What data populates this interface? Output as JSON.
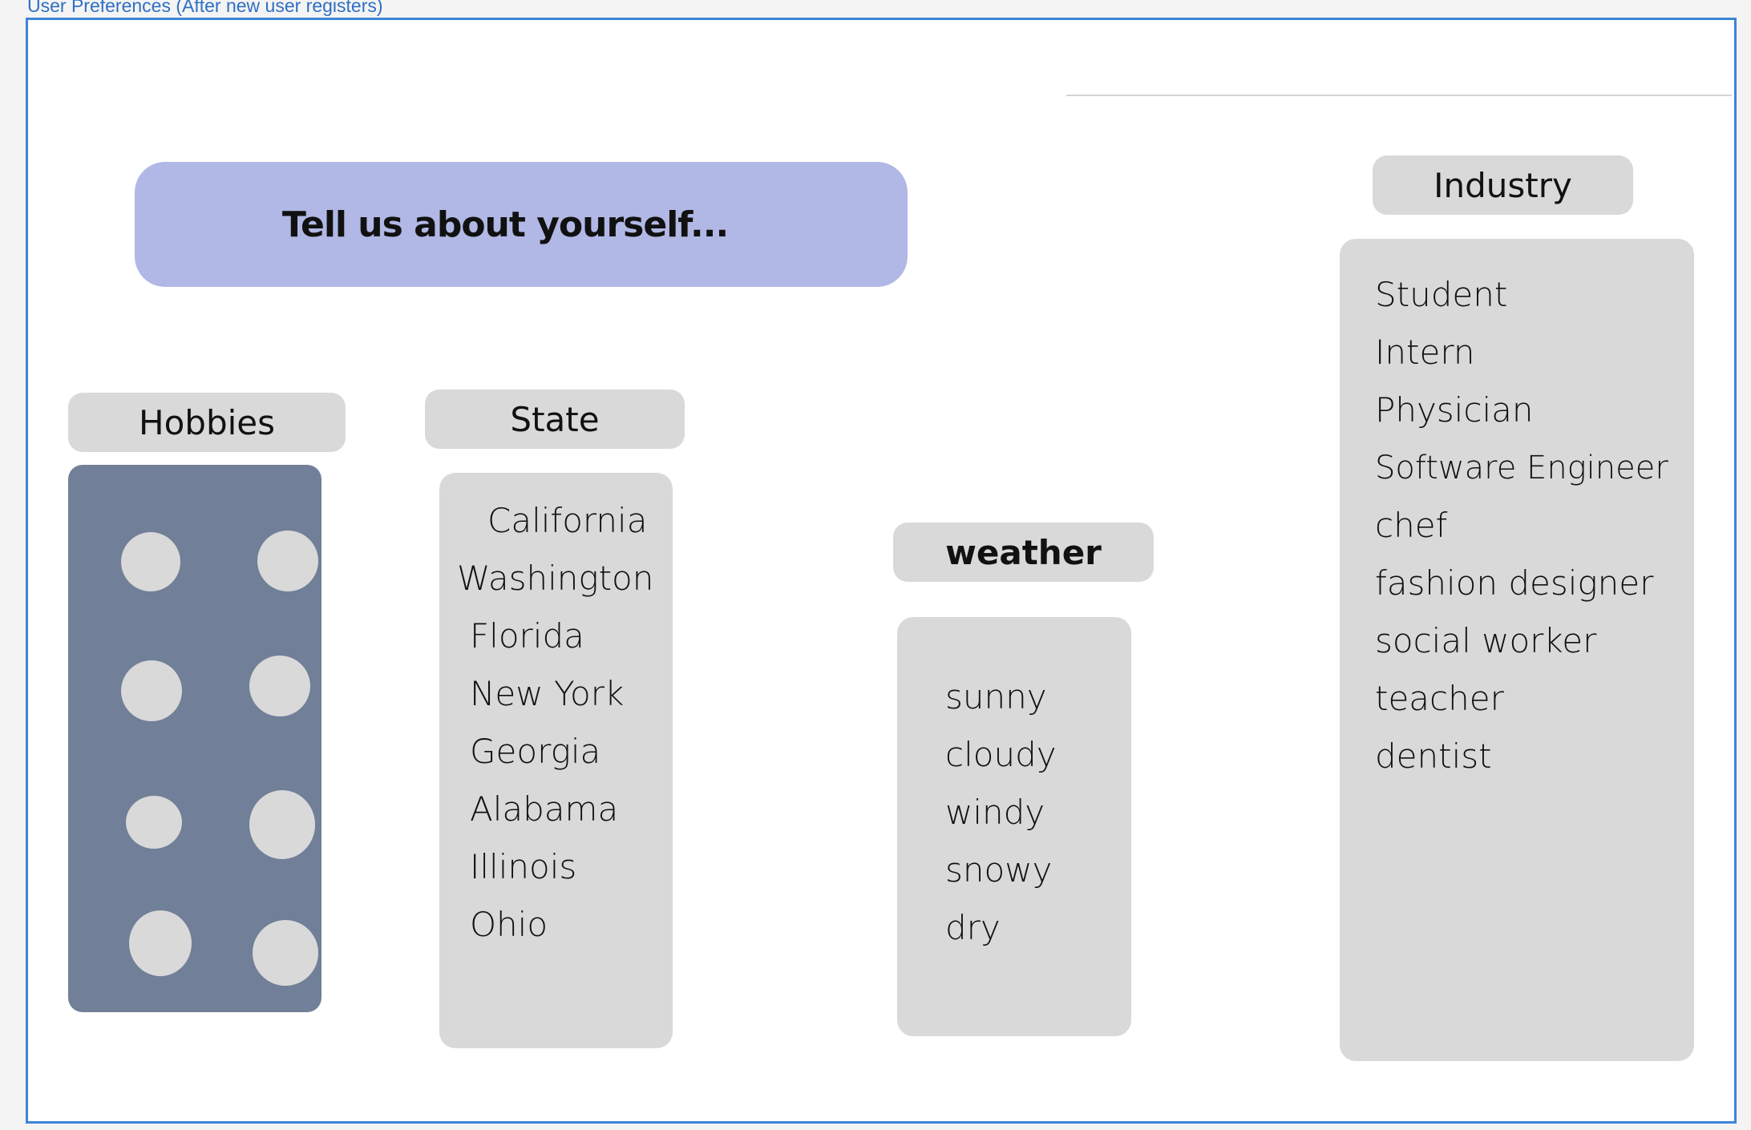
{
  "frame": {
    "label": "User Preferences (After new user registers)"
  },
  "banner": {
    "text": "Tell us about yourself..."
  },
  "hobbies": {
    "label": "Hobbies",
    "option_count": 8
  },
  "state": {
    "label": "State",
    "options": [
      "California",
      "Washington",
      "Florida",
      "New York",
      "Georgia",
      "Alabama",
      "Illinois",
      "Ohio"
    ]
  },
  "weather": {
    "label": "weather",
    "options": [
      "sunny",
      "cloudy",
      "windy",
      "snowy",
      "dry"
    ]
  },
  "industry": {
    "label": "Industry",
    "options": [
      "Student",
      "Intern",
      "Physician",
      "Software Engineer",
      "chef",
      "fashion designer",
      "social worker",
      "teacher",
      "dentist"
    ]
  },
  "colors": {
    "banner": "#b1b8e5",
    "pill": "#d9d9d9",
    "hobbies_panel": "#717f98",
    "frame_border": "#3d84d8"
  }
}
